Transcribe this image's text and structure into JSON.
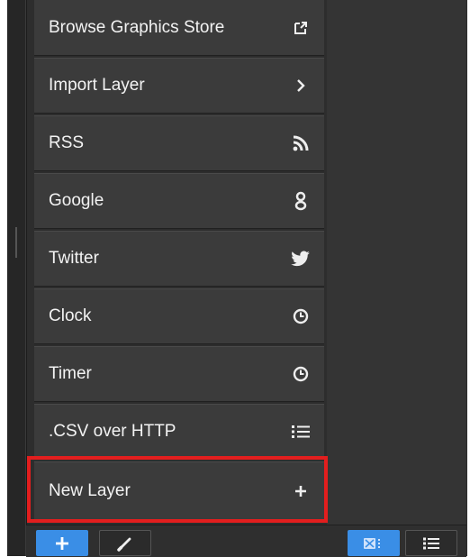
{
  "menu": {
    "items": [
      {
        "label": "Browse Graphics Store",
        "icon": "external-link-icon"
      },
      {
        "label": "Import Layer",
        "icon": "chevron-right-icon"
      },
      {
        "label": "RSS",
        "icon": "rss-icon"
      },
      {
        "label": "Google",
        "icon": "google-icon"
      },
      {
        "label": "Twitter",
        "icon": "twitter-icon"
      },
      {
        "label": "Clock",
        "icon": "clock-icon"
      },
      {
        "label": "Timer",
        "icon": "clock-icon"
      },
      {
        "label": ".CSV over HTTP",
        "icon": "list-icon"
      },
      {
        "label": "New Layer",
        "icon": "plus-icon"
      }
    ]
  },
  "toolbar": {
    "add_icon": "plus-icon",
    "edit_icon": "brush-icon",
    "grid_view_icon": "grid-view-icon",
    "list_view_icon": "list-view-icon"
  },
  "colors": {
    "accent": "#3a8ee6",
    "highlight": "#e31e1e",
    "panel": "#2d2d2d",
    "menu_item": "#3b3b3b"
  }
}
